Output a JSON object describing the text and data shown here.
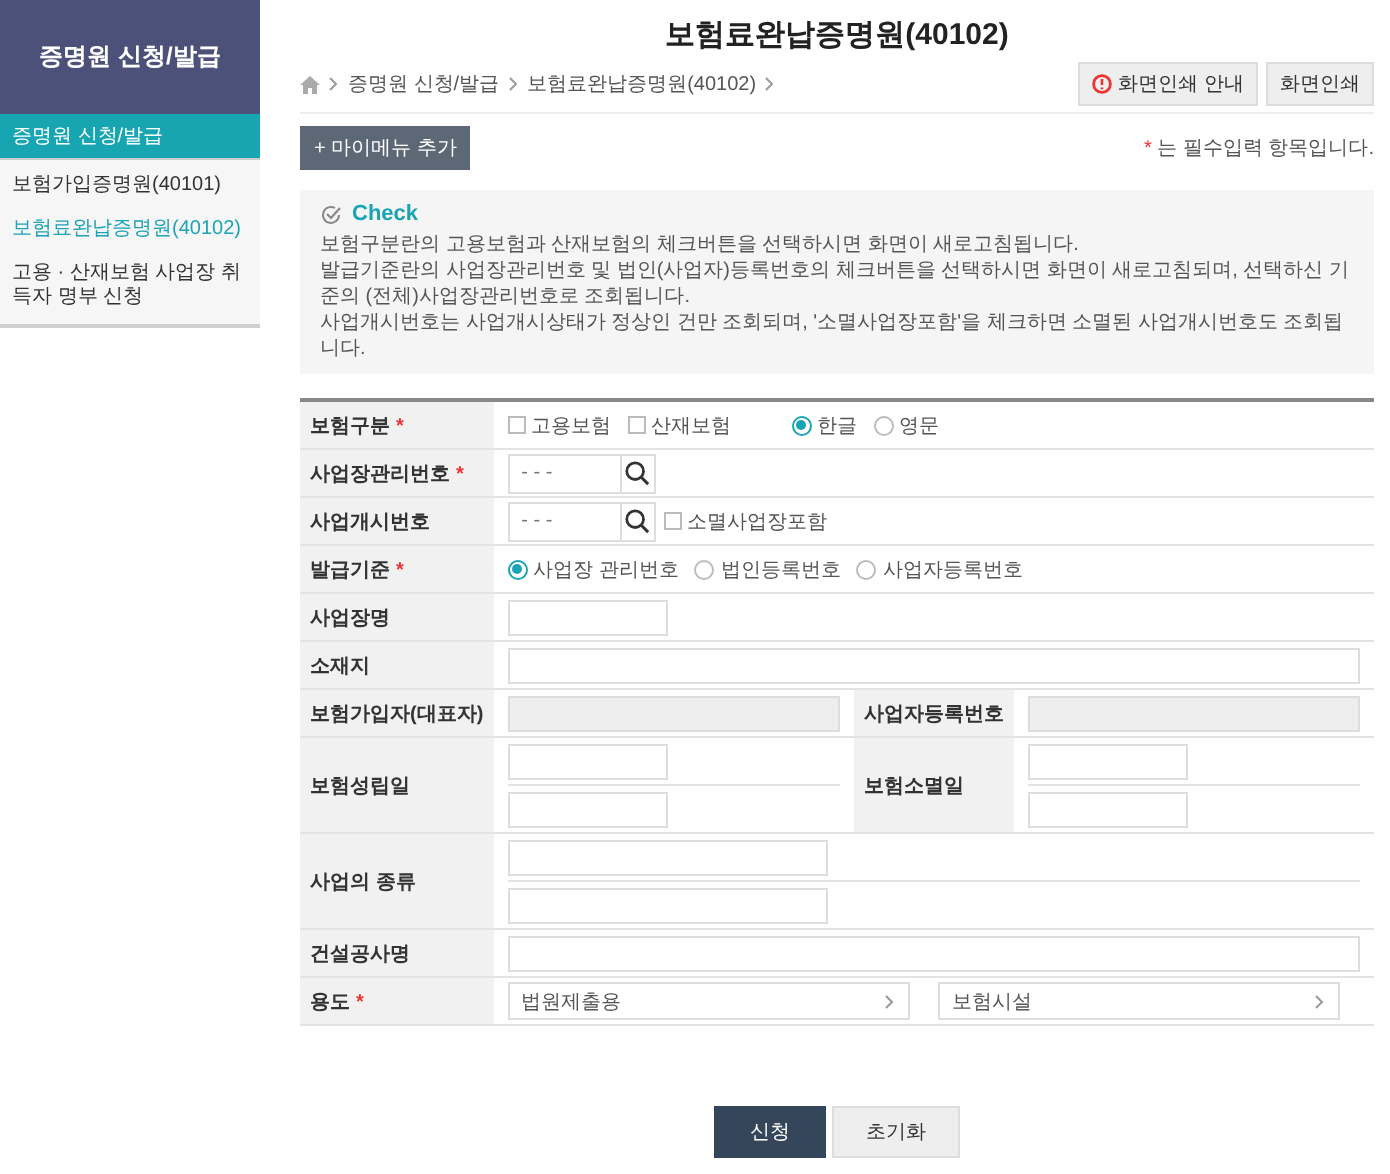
{
  "sidebar": {
    "title": "증명원 신청/발급",
    "section": "증명원 신청/발급",
    "items": [
      {
        "label": "보험가입증명원(40101)",
        "selected": false
      },
      {
        "label": "보험료완납증명원(40102)",
        "selected": true
      },
      {
        "label": "고용 · 산재보험 사업장 취득자 명부 신청",
        "selected": false
      }
    ]
  },
  "page": {
    "title": "보험료완납증명원(40102)",
    "breadcrumb": [
      "증명원 신청/발급",
      "보험료완납증명원(40102)"
    ],
    "print_guide_button": "화면인쇄 안내",
    "print_button": "화면인쇄",
    "my_menu_button": "+ 마이메뉴 추가",
    "required_note": {
      "mark": "*",
      "text": "는 필수입력 항목입니다."
    }
  },
  "check": {
    "title": "Check",
    "lines": [
      "보험구분란의 고용보험과 산재보험의 체크버튼을 선택하시면 화면이 새로고침됩니다.",
      "발급기준란의 사업장관리번호 및 법인(사업자)등록번호의 체크버튼을 선택하시면 화면이 새로고침되며, 선택하신 기준의 (전체)사업장관리번호로 조회됩니다.",
      "사업개시번호는 사업개시상태가 정상인 건만 조회되며, '소멸사업장포함'을 체크하면 소멸된 사업개시번호도 조회됩니다."
    ]
  },
  "form": {
    "required_mark": "*",
    "rows": [
      {
        "cells": [
          {
            "label": "보험구분",
            "required": true,
            "lines": [
              [
                {
                  "kind": "checkbox",
                  "label": "고용보험",
                  "checked": false
                },
                {
                  "kind": "checkbox",
                  "label": "산재보험",
                  "checked": false
                },
                {
                  "kind": "radio",
                  "label": "한글",
                  "selected": true
                },
                {
                  "kind": "radio",
                  "label": "영문",
                  "selected": false
                }
              ]
            ]
          }
        ]
      },
      {
        "cells": [
          {
            "label": "사업장관리번호",
            "required": true,
            "lines": [
              [
                {
                  "kind": "search",
                  "placeholder": "- - -"
                }
              ]
            ]
          }
        ]
      },
      {
        "cells": [
          {
            "label": "사업개시번호",
            "required": false,
            "lines": [
              [
                {
                  "kind": "search",
                  "placeholder": "- - -"
                },
                {
                  "kind": "checkbox",
                  "label": "소멸사업장포함",
                  "checked": false
                }
              ]
            ]
          }
        ]
      },
      {
        "cells": [
          {
            "label": "발급기준",
            "required": true,
            "lines": [
              [
                {
                  "kind": "radio",
                  "label": "사업장 관리번호",
                  "selected": true
                },
                {
                  "kind": "radio",
                  "label": "법인등록번호",
                  "selected": false
                },
                {
                  "kind": "radio",
                  "label": "사업자등록번호",
                  "selected": false
                }
              ]
            ]
          }
        ]
      },
      {
        "cells": [
          {
            "label": "사업장명",
            "required": false,
            "lines": [
              [
                {
                  "kind": "short_input"
                }
              ]
            ]
          }
        ]
      },
      {
        "cells": [
          {
            "label": "소재지",
            "required": false,
            "lines": [
              [
                {
                  "kind": "wide_input"
                }
              ]
            ]
          }
        ]
      },
      {
        "cells": [
          {
            "label": "보험가입자(대표자)",
            "required": false,
            "lines": [
              [
                {
                  "kind": "readonly_input"
                }
              ]
            ]
          },
          {
            "label": "사업자등록번호",
            "required": false,
            "lines": [
              [
                {
                  "kind": "readonly_input"
                }
              ]
            ]
          }
        ]
      },
      {
        "cells": [
          {
            "label": "보험성립일",
            "required": false,
            "lines": [
              [
                {
                  "kind": "short_input"
                }
              ],
              [
                {
                  "kind": "short_input"
                }
              ]
            ]
          },
          {
            "label": "보험소멸일",
            "required": false,
            "lines": [
              [
                {
                  "kind": "short_input"
                }
              ],
              [
                {
                  "kind": "short_input"
                }
              ]
            ]
          }
        ]
      },
      {
        "cells": [
          {
            "label": "사업의 종류",
            "required": false,
            "lines": [
              [
                {
                  "kind": "medium_input"
                }
              ],
              [
                {
                  "kind": "medium_input"
                }
              ]
            ]
          }
        ]
      },
      {
        "cells": [
          {
            "label": "건설공사명",
            "required": false,
            "lines": [
              [
                {
                  "kind": "wide_input"
                }
              ]
            ]
          }
        ]
      },
      {
        "cells": [
          {
            "label": "용도",
            "required": true,
            "lines": [
              [
                {
                  "kind": "select",
                  "value": "법원제출용"
                },
                {
                  "kind": "select",
                  "value": "보험시설"
                }
              ]
            ]
          }
        ]
      }
    ]
  },
  "actions": {
    "submit": "신청",
    "reset": "초기화"
  }
}
